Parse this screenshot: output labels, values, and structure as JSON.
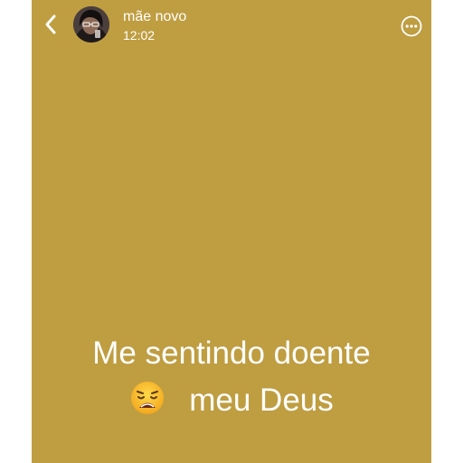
{
  "colors": {
    "background": "#bf9d41",
    "text": "#ffffff"
  },
  "header": {
    "back_icon": "chevron-left-icon",
    "user_name": "mãe novo",
    "time": "12:02",
    "more_icon": "more-horizontal-circle-icon"
  },
  "status": {
    "line1": "Me sentindo doente",
    "emoji": "weary-face-emoji",
    "line2": "meu Deus"
  }
}
